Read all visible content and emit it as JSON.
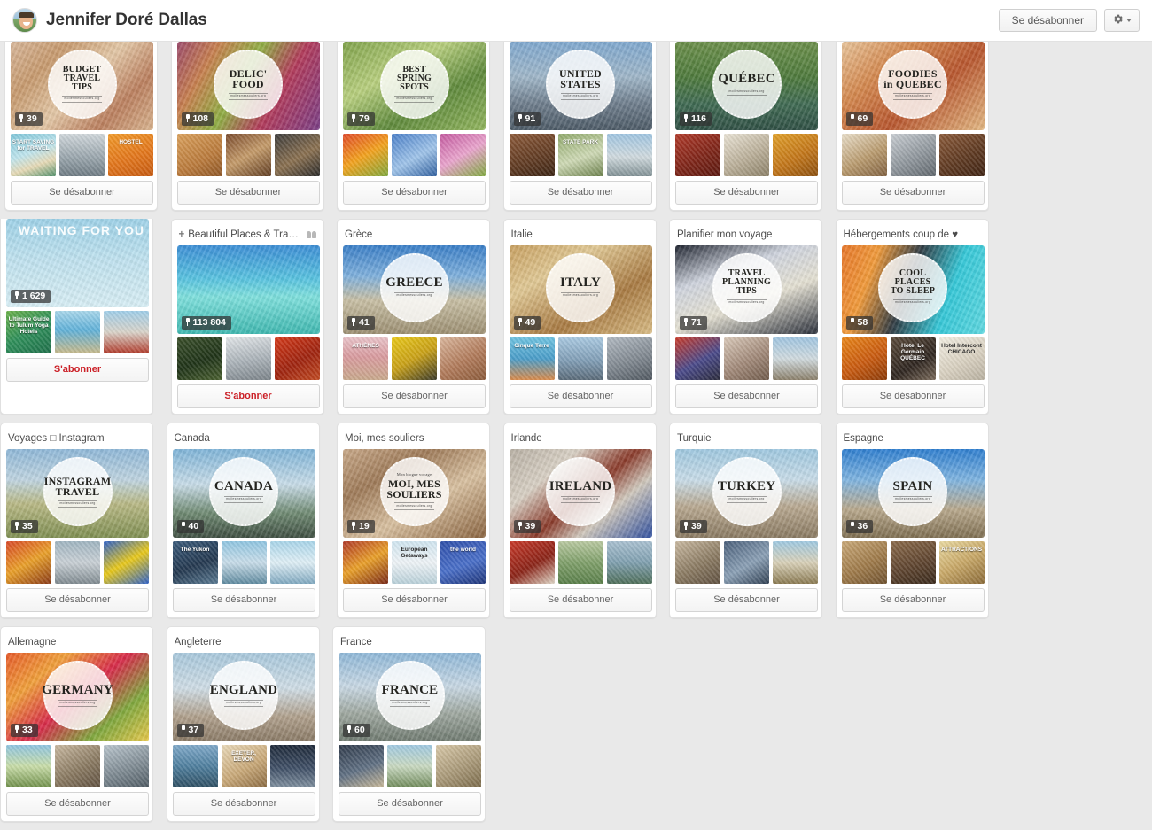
{
  "header": {
    "profile_name": "Jennifer Doré Dallas",
    "avatar_name": "profile-avatar",
    "unfollow_label": "Se désabonner",
    "gear_icon": "gear-icon"
  },
  "labels": {
    "follow": "S'abonner",
    "unfollow": "Se désabonner"
  },
  "boards": [
    {
      "title": "",
      "cut": true,
      "pins": "39",
      "stamp": [
        "BUDGET",
        "TRAVEL",
        "TIPS"
      ],
      "stamp_sub": "moilesmessouliers.org",
      "hero_css": "linear-gradient(135deg,#d8b79a 0%,#c79a6e 25%,#e3c7a6 50%,#bb7f5e 75%,#d9b48f 100%)",
      "banner": "",
      "thumbs": [
        {
          "cap": "START SAVING for TRAVEL",
          "dark": false,
          "css": "linear-gradient(160deg,#7fc5d8 0%,#bfe4ec 45%,#e6d9b5 70%,#4f8f6a 100%)"
        },
        {
          "cap": "",
          "dark": false,
          "css": "linear-gradient(180deg,#cfd6da 0%,#9aa6ad 55%,#6d7a82 100%)"
        },
        {
          "cap": "HOSTEL",
          "dark": false,
          "css": "linear-gradient(160deg,#f09a2a 0%,#e2761c 55%,#c55a12 100%)"
        }
      ]
    },
    {
      "title": "",
      "cut": true,
      "pins": "108",
      "stamp": [
        "DELIC'",
        "FOOD"
      ],
      "stamp_sub": "moilesmessouliers.org",
      "hero_css": "linear-gradient(120deg,#9c4a6b 0%,#c77f4e 22%,#8fae44 45%,#b23a5a 68%,#7a3f86 100%)",
      "banner": "",
      "thumbs": [
        {
          "cap": "",
          "dark": false,
          "css": "linear-gradient(150deg,#d9a05c 0%,#b97a3c 60%,#8c5526 100%)"
        },
        {
          "cap": "",
          "dark": false,
          "css": "linear-gradient(150deg,#7a4b2e 0%,#c49b6a 50%,#5d3a20 100%)"
        },
        {
          "cap": "",
          "dark": false,
          "css": "linear-gradient(150deg,#3d3d3d 0%,#8a7050 55%,#2a2a2a 100%)"
        }
      ]
    },
    {
      "title": "",
      "cut": true,
      "pins": "79",
      "stamp": [
        "BEST",
        "SPRING",
        "SPOTS"
      ],
      "stamp_sub": "moilesmessouliers.org",
      "hero_css": "linear-gradient(150deg,#7fa24a 0%,#b8cf7e 35%,#5f8a3c 65%,#92b55e 100%)",
      "banner": "",
      "thumbs": [
        {
          "cap": "",
          "dark": false,
          "css": "linear-gradient(150deg,#e04a2a 0%,#f2a21e 50%,#7fa83e 100%)"
        },
        {
          "cap": "",
          "dark": false,
          "css": "linear-gradient(150deg,#4a7fc8 0%,#9fc3e8 55%,#2f5f9e 100%)"
        },
        {
          "cap": "",
          "dark": false,
          "css": "linear-gradient(150deg,#c45aa0 0%,#e8a4cc 50%,#7fa83e 100%)"
        }
      ]
    },
    {
      "title": "",
      "cut": true,
      "pins": "91",
      "stamp": [
        "UNITED",
        "STATES"
      ],
      "stamp_sub": "moilesmessouliers.org",
      "hero_css": "linear-gradient(180deg,#7fa8cf 0%,#9fb6c8 40%,#6e7d8c 70%,#4c5a66 100%)",
      "banner": "",
      "thumbs": [
        {
          "cap": "",
          "dark": false,
          "css": "linear-gradient(160deg,#8c5a3a 0%,#5f3a22 60%,#3a2414 100%)"
        },
        {
          "cap": "STATE PARK",
          "dark": false,
          "css": "linear-gradient(160deg,#8fa86a 0%,#cdd8b4 55%,#6a7f4a 100%)"
        },
        {
          "cap": "",
          "dark": false,
          "css": "linear-gradient(180deg,#9fc4e0 0%,#cfd9dd 55%,#7f8f93 100%)"
        }
      ]
    },
    {
      "title": "",
      "cut": true,
      "pins": "116",
      "stamp": [
        "QUÉBEC"
      ],
      "stamp_sub": "moilesmessouliers.org",
      "hero_css": "linear-gradient(180deg,#6b8f4a 0%,#4e7a3c 40%,#3f6a52 70%,#2f4f44 100%)",
      "banner": "",
      "thumbs": [
        {
          "cap": "",
          "dark": false,
          "css": "linear-gradient(150deg,#b03a2a 0%,#7a2418 60%,#5a1810 100%)"
        },
        {
          "cap": "",
          "dark": false,
          "css": "linear-gradient(150deg,#e8e2d4 0%,#b9ae98 55%,#8a7f66 100%)"
        },
        {
          "cap": "",
          "dark": false,
          "css": "linear-gradient(150deg,#e0a02a 0%,#c2761a 55%,#8a4f10 100%)"
        }
      ]
    },
    {
      "title": "",
      "cut": true,
      "pins": "69",
      "stamp": [
        "FOODIES",
        "in QUEBEC"
      ],
      "stamp_sub": "moilesmessouliers.org",
      "hero_css": "linear-gradient(140deg,#e8c49a 0%,#d4884e 30%,#b8562e 60%,#e3b883 100%)",
      "banner": "",
      "thumbs": [
        {
          "cap": "",
          "dark": false,
          "css": "linear-gradient(150deg,#e8ddc8 0%,#b89a6e 55%,#7f6040 100%)"
        },
        {
          "cap": "",
          "dark": false,
          "css": "linear-gradient(150deg,#c8cdd2 0%,#8f969c 55%,#5f666c 100%)"
        },
        {
          "cap": "",
          "dark": false,
          "css": "linear-gradient(150deg,#8a5a3a 0%,#5f3a22 55%,#3f2414 100%)"
        }
      ]
    },
    {
      "title": "",
      "cut": true,
      "pins": "1 629",
      "stamp": [],
      "stamp_sub": "",
      "hero_css": "linear-gradient(180deg,#9ed2e8 0%,#bfe2ef 45%,#d8eef5 100%)",
      "banner": "WAITING FOR YOU",
      "follow_style": "subscribe",
      "thumbs": [
        {
          "cap": "Ultimate Guide to Tulum Yoga Hotels",
          "dark": false,
          "css": "linear-gradient(150deg,#6ab04a 0%,#2f8f5a 50%,#1f6f4a 100%)"
        },
        {
          "cap": "",
          "dark": false,
          "css": "linear-gradient(180deg,#a8d6ea 0%,#5fb0d8 45%,#c8b98a 100%)"
        },
        {
          "cap": "",
          "dark": false,
          "css": "linear-gradient(180deg,#9fcde8 0%,#d8d2c8 50%,#b03a2a 100%)"
        }
      ]
    },
    {
      "title": "Beautiful Places & Trave...",
      "plus": true,
      "collab": true,
      "pins": "113 804",
      "stamp": [],
      "stamp_sub": "",
      "hero_css": "linear-gradient(180deg,#3d8fd6 0%,#58c3e0 38%,#7fe0dd 58%,#3fb8b0 100%)",
      "banner": "",
      "follow_style": "subscribe",
      "thumbs": [
        {
          "cap": "",
          "dark": false,
          "css": "linear-gradient(160deg,#3a4f2a 0%,#1f3318 55%,#4a6030 100%)"
        },
        {
          "cap": "",
          "dark": false,
          "css": "linear-gradient(170deg,#dfe3e6 0%,#a8b0b6 55%,#7a8288 100%)"
        },
        {
          "cap": "",
          "dark": false,
          "css": "linear-gradient(150deg,#d43a1a 0%,#9e2410 55%,#c04a22 100%)"
        }
      ]
    },
    {
      "title": "Grèce",
      "pins": "41",
      "stamp": [
        "GREECE"
      ],
      "stamp_sub": "moilesmessouliers.org",
      "hero_css": "linear-gradient(180deg,#3a7fc8 0%,#7fb0dc 35%,#c8bfa4 62%,#9c8f72 100%)",
      "banner": "",
      "thumbs": [
        {
          "cap": "ATHÈNES",
          "dark": false,
          "css": "linear-gradient(180deg,#e8c2c8 0%,#d89a9e 45%,#c8a88c 100%)"
        },
        {
          "cap": "",
          "dark": false,
          "css": "linear-gradient(150deg,#e8c81a 0%,#c8a018 50%,#3a3a2a 100%)"
        },
        {
          "cap": "",
          "dark": false,
          "css": "linear-gradient(150deg,#d8b49a 0%,#b07a5a 55%,#8a5a3a 100%)"
        }
      ]
    },
    {
      "title": "Italie",
      "pins": "49",
      "stamp": [
        "ITALY"
      ],
      "stamp_sub": "moilesmessouliers.org",
      "hero_css": "linear-gradient(150deg,#c8a060 0%,#e0c894 30%,#a87a42 65%,#d8bb84 100%)",
      "banner": "",
      "thumbs": [
        {
          "cap": "Cinque Terre",
          "dark": false,
          "css": "linear-gradient(180deg,#6fc2e0 0%,#4a9cc8 50%,#d88a4a 100%)"
        },
        {
          "cap": "",
          "dark": false,
          "css": "linear-gradient(180deg,#a8c8e0 0%,#7f9cb4 55%,#5a6a78 100%)"
        },
        {
          "cap": "",
          "dark": false,
          "css": "linear-gradient(160deg,#b0b8c0 0%,#7f878f 55%,#4f575f 100%)"
        }
      ]
    },
    {
      "title": "Planifier mon voyage",
      "pins": "71",
      "stamp": [
        "TRAVEL",
        "PLANNING",
        "TIPS"
      ],
      "stamp_sub": "moilesmessouliers.org",
      "hero_css": "linear-gradient(160deg,#1f2430 0%,#cfd4de 32%,#e4e0d2 60%,#2a2f3a 100%)",
      "banner": "",
      "thumbs": [
        {
          "cap": "",
          "dark": false,
          "css": "linear-gradient(150deg,#c83a2a 0%,#4a4a8a 55%,#2a2a3a 100%)"
        },
        {
          "cap": "",
          "dark": false,
          "css": "linear-gradient(150deg,#d8c8b8 0%,#a08878 55%,#6f5a4a 100%)"
        },
        {
          "cap": "",
          "dark": false,
          "css": "linear-gradient(180deg,#9fc4e0 0%,#cfd9dd 50%,#8a7f6a 100%)"
        }
      ]
    },
    {
      "title": "Hébergements coup de ♥",
      "pins": "58",
      "stamp": [
        "COOL",
        "PLACES",
        "TO SLEEP"
      ],
      "stamp_sub": "moilesmessouliers.org",
      "hero_css": "linear-gradient(110deg,#e8772a 0%,#f09a3a 22%,#2f3a42 46%,#35c8d8 72%,#5fd8e0 100%)",
      "banner": "",
      "thumbs": [
        {
          "cap": "",
          "dark": false,
          "css": "linear-gradient(150deg,#e8861a 0%,#c85a10 55%,#8a3a08 100%)"
        },
        {
          "cap": "Hotel Le Germain QUÉBEC",
          "dark": false,
          "css": "linear-gradient(150deg,#5a4a3a 0%,#2f2620 60%,#7a6a5a 100%)"
        },
        {
          "cap": "Hotel Intercont CHICAGO",
          "dark": true,
          "css": "linear-gradient(150deg,#f0ece0 0%,#d8d0c0 55%,#b8b0a0 100%)"
        }
      ]
    },
    {
      "title": "Voyages □ Instagram",
      "pins": "35",
      "stamp": [
        "INSTAGRAM",
        "TRAVEL"
      ],
      "stamp_sub": "moilesmessouliers.org",
      "hero_css": "linear-gradient(180deg,#8fb8d8 0%,#bfd4e0 35%,#b8b884 62%,#7f8f52 100%)",
      "banner": "",
      "thumbs": [
        {
          "cap": "",
          "dark": false,
          "css": "linear-gradient(150deg,#d84a2a 0%,#e8a02a 50%,#8a3a18 100%)"
        },
        {
          "cap": "",
          "dark": false,
          "css": "linear-gradient(180deg,#9fb4c0 0%,#c8cfd4 50%,#7f8a90 100%)"
        },
        {
          "cap": "",
          "dark": false,
          "css": "linear-gradient(150deg,#2f62c8 0%,#e8c81a 50%,#2f62c8 100%)"
        }
      ]
    },
    {
      "title": "Canada",
      "pins": "40",
      "stamp": [
        "CANADA"
      ],
      "stamp_sub": "moilesmessouliers.org",
      "hero_css": "linear-gradient(180deg,#7fb4d8 0%,#c8dce8 40%,#6f8a72 72%,#3f4f42 100%)",
      "banner": "",
      "thumbs": [
        {
          "cap": "The Yukon",
          "dark": false,
          "css": "linear-gradient(160deg,#3a5a7a 0%,#24384f 55%,#5a7a92 100%)"
        },
        {
          "cap": "",
          "dark": false,
          "css": "linear-gradient(180deg,#8fc4e0 0%,#c8dce8 50%,#5f8a9f 100%)"
        },
        {
          "cap": "",
          "dark": false,
          "css": "linear-gradient(180deg,#a8d4e8 0%,#dfeef5 50%,#7fa8bf 100%)"
        }
      ]
    },
    {
      "title": "Moi, mes souliers",
      "pins": "19",
      "stamp": [
        "MOI, MES",
        "SOULIERS"
      ],
      "stamp_sub": "moilesmessouliers.org",
      "stamp_top": "Mon blogue voyage",
      "hero_css": "linear-gradient(150deg,#c8a888 0%,#9e7a58 30%,#d8c0a0 60%,#8a6440 100%)",
      "banner": "",
      "thumbs": [
        {
          "cap": "",
          "dark": false,
          "css": "linear-gradient(150deg,#b03a2a 0%,#e8a02a 50%,#7a2a18 100%)"
        },
        {
          "cap": "European Getaways",
          "dark": true,
          "css": "linear-gradient(180deg,#cfe4ef 0%,#eef3f6 50%,#b8cfd8 100%)"
        },
        {
          "cap": "the world",
          "dark": false,
          "css": "linear-gradient(160deg,#2f4fa8 0%,#4a6fc8 55%,#1f3578 100%)"
        }
      ]
    },
    {
      "title": "Irlande",
      "pins": "39",
      "stamp": [
        "IRELAND"
      ],
      "stamp_sub": "moilesmessouliers.org",
      "hero_css": "linear-gradient(140deg,#b8b0a4 0%,#d8d0c4 28%,#8a3a2a 52%,#d0c8bc 70%,#2f4f9e 100%)",
      "banner": "",
      "thumbs": [
        {
          "cap": "",
          "dark": false,
          "css": "linear-gradient(150deg,#c83a2a 0%,#8a2418 55%,#e0d8c8 100%)"
        },
        {
          "cap": "",
          "dark": false,
          "css": "linear-gradient(180deg,#b8c8a0 0%,#7f9f6a 50%,#5a7f4a 100%)"
        },
        {
          "cap": "",
          "dark": false,
          "css": "linear-gradient(180deg,#a8bfcf 0%,#7f9faf 50%,#4f6f5a 100%)"
        }
      ]
    },
    {
      "title": "Turquie",
      "pins": "39",
      "stamp": [
        "TURKEY"
      ],
      "stamp_sub": "moilesmessouliers.org",
      "hero_css": "linear-gradient(180deg,#9fc8e0 0%,#c8dce8 35%,#b8a890 65%,#8a7a62 100%)",
      "banner": "",
      "thumbs": [
        {
          "cap": "",
          "dark": false,
          "css": "linear-gradient(150deg,#c8b8a0 0%,#8a7a62 55%,#5f5040 100%)"
        },
        {
          "cap": "",
          "dark": false,
          "css": "linear-gradient(150deg,#4a5f7a 0%,#8a9fb4 55%,#2f3f52 100%)"
        },
        {
          "cap": "",
          "dark": false,
          "css": "linear-gradient(180deg,#9fc8e0 0%,#d8d0b8 50%,#8a7a52 100%)"
        }
      ]
    },
    {
      "title": "Espagne",
      "pins": "36",
      "stamp": [
        "SPAIN"
      ],
      "stamp_sub": "moilesmessouliers.org",
      "hero_css": "linear-gradient(180deg,#2f7fd0 0%,#7fb4e0 35%,#b8a88c 68%,#7f6f52 100%)",
      "banner": "",
      "thumbs": [
        {
          "cap": "",
          "dark": false,
          "css": "linear-gradient(150deg,#c8a878 0%,#9e7a4a 55%,#6f5230 100%)"
        },
        {
          "cap": "",
          "dark": false,
          "css": "linear-gradient(160deg,#8a6a4a 0%,#5f4530 55%,#3a2a1c 100%)"
        },
        {
          "cap": "ATTRACTIONS",
          "dark": false,
          "css": "linear-gradient(150deg,#e8d8a0 0%,#c8a868 50%,#8a6a38 100%)"
        }
      ]
    },
    {
      "title": "Allemagne",
      "pins": "33",
      "stamp": [
        "GERMANY"
      ],
      "stamp_sub": "moilesmessouliers.org",
      "hero_css": "linear-gradient(140deg,#e85a2a 0%,#f0a03a 25%,#d82a4a 50%,#7fa83e 75%,#e8c84a 100%)",
      "banner": "",
      "thumbs": [
        {
          "cap": "",
          "dark": false,
          "css": "linear-gradient(180deg,#8fc4e0 0%,#c8dca8 50%,#6f8f4a 100%)"
        },
        {
          "cap": "",
          "dark": false,
          "css": "linear-gradient(150deg,#c8b8a0 0%,#8a7a62 55%,#5f5040 100%)"
        },
        {
          "cap": "",
          "dark": false,
          "css": "linear-gradient(160deg,#b8c4cc 0%,#7f8b93 55%,#4f5b63 100%)"
        }
      ]
    },
    {
      "title": "Angleterre",
      "pins": "37",
      "stamp": [
        "ENGLAND"
      ],
      "stamp_sub": "moilesmessouliers.org",
      "hero_css": "linear-gradient(180deg,#a8c8dc 0%,#cfdde6 40%,#b0a08c 72%,#8a7a66 100%)",
      "banner": "",
      "thumbs": [
        {
          "cap": "",
          "dark": false,
          "css": "linear-gradient(180deg,#7fa8c8 0%,#4f7f9e 50%,#2f4f62 100%)"
        },
        {
          "cap": "EXETER, DEVON",
          "dark": false,
          "css": "linear-gradient(150deg,#e8d8b8 0%,#c8a878 55%,#8a6a42 100%)"
        },
        {
          "cap": "",
          "dark": false,
          "css": "linear-gradient(180deg,#1f2a3a 0%,#3f4f66 55%,#7f8f9e 100%)"
        }
      ]
    },
    {
      "title": "France",
      "pins": "60",
      "stamp": [
        "FRANCE"
      ],
      "stamp_sub": "moilesmessouliers.org",
      "hero_css": "linear-gradient(180deg,#8fb8d8 0%,#c8d8e4 38%,#9fa8a0 68%,#6f7a70 100%)",
      "banner": "",
      "thumbs": [
        {
          "cap": "",
          "dark": false,
          "css": "linear-gradient(160deg,#2f3a4a 0%,#5f6f82 55%,#c8b898 100%)"
        },
        {
          "cap": "",
          "dark": false,
          "css": "linear-gradient(180deg,#9fc8e0 0%,#c8d8c0 50%,#6f8a5a 100%)"
        },
        {
          "cap": "",
          "dark": false,
          "css": "linear-gradient(150deg,#d8c8a8 0%,#a89878 55%,#7a6a4a 100%)"
        }
      ]
    }
  ]
}
